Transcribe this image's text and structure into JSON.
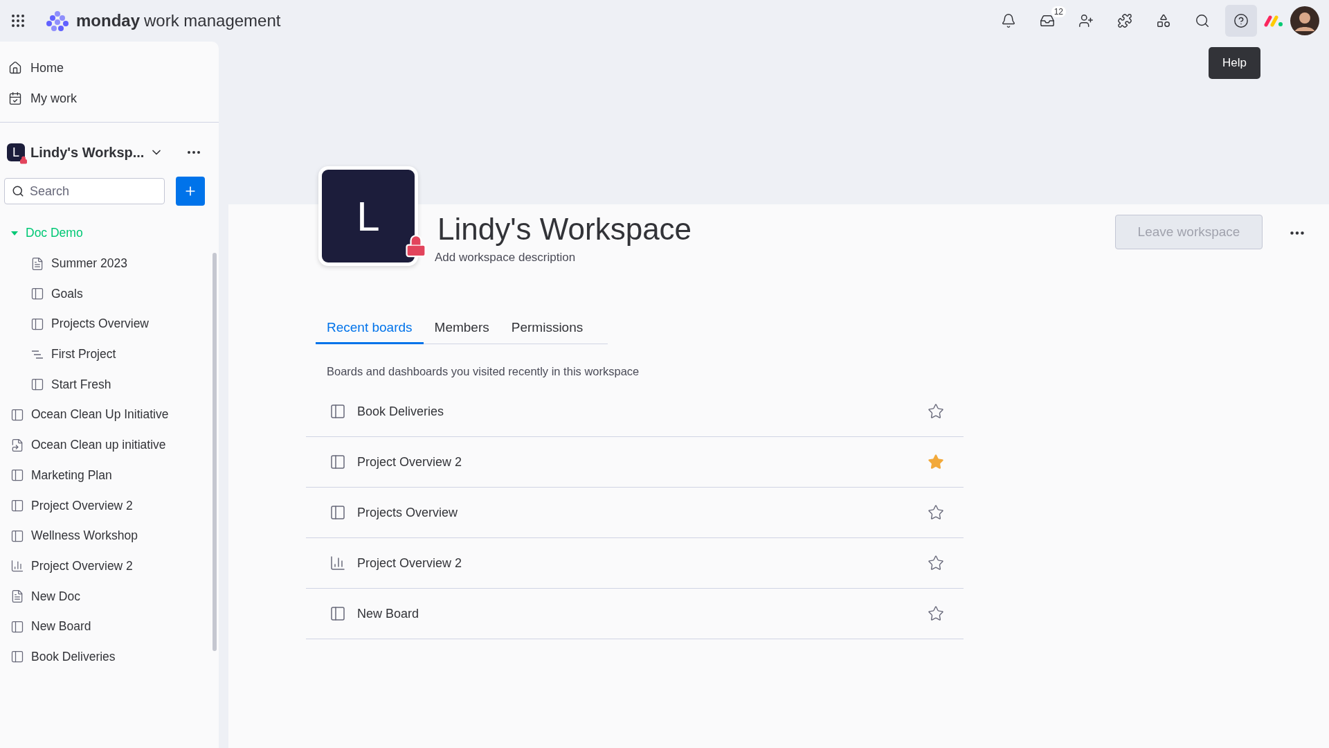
{
  "top_bar": {
    "brand": "monday",
    "product": "work management",
    "inbox_badge": "12",
    "tooltip": "Help"
  },
  "sidebar": {
    "nav": [
      {
        "label": "Home",
        "kind": "home"
      },
      {
        "label": "My work",
        "kind": "mywork"
      }
    ],
    "workspace": {
      "initial": "L",
      "name": "Lindy's Worksp..."
    },
    "search": {
      "placeholder": "Search"
    },
    "tree": [
      {
        "label": "Doc Demo",
        "kind": "folder",
        "expanded": true,
        "children": [
          {
            "label": "Summer 2023",
            "kind": "doc"
          },
          {
            "label": "Goals",
            "kind": "board"
          },
          {
            "label": "Projects Overview",
            "kind": "board"
          },
          {
            "label": "First Project",
            "kind": "gantt"
          },
          {
            "label": "Start Fresh",
            "kind": "board"
          }
        ]
      },
      {
        "label": "Ocean Clean Up Initiative",
        "kind": "board"
      },
      {
        "label": "Ocean Clean up initiative",
        "kind": "workflow"
      },
      {
        "label": "Marketing Plan",
        "kind": "board"
      },
      {
        "label": "Project Overview 2",
        "kind": "board"
      },
      {
        "label": "Wellness Workshop",
        "kind": "board"
      },
      {
        "label": "Project Overview 2",
        "kind": "dashboard"
      },
      {
        "label": "New Doc",
        "kind": "doc"
      },
      {
        "label": "New Board",
        "kind": "board"
      },
      {
        "label": "Book Deliveries",
        "kind": "board"
      }
    ]
  },
  "workspace": {
    "initial": "L",
    "title": "Lindy's Workspace",
    "description": "Add workspace description",
    "leave_button": {
      "label": "Leave workspace",
      "disabled": true
    }
  },
  "tabs": [
    {
      "label": "Recent boards",
      "selected": true
    },
    {
      "label": "Members",
      "selected": false
    },
    {
      "label": "Permissions",
      "selected": false
    }
  ],
  "caption": "Boards and dashboards you visited recently in this workspace",
  "boards": [
    {
      "name": "Book Deliveries",
      "kind": "board",
      "starred": false
    },
    {
      "name": "Project Overview 2",
      "kind": "board",
      "starred": true
    },
    {
      "name": "Projects Overview",
      "kind": "board",
      "starred": false
    },
    {
      "name": "Project Overview 2",
      "kind": "dashboard",
      "starred": false
    },
    {
      "name": "New Board",
      "kind": "board",
      "starred": false
    }
  ]
}
